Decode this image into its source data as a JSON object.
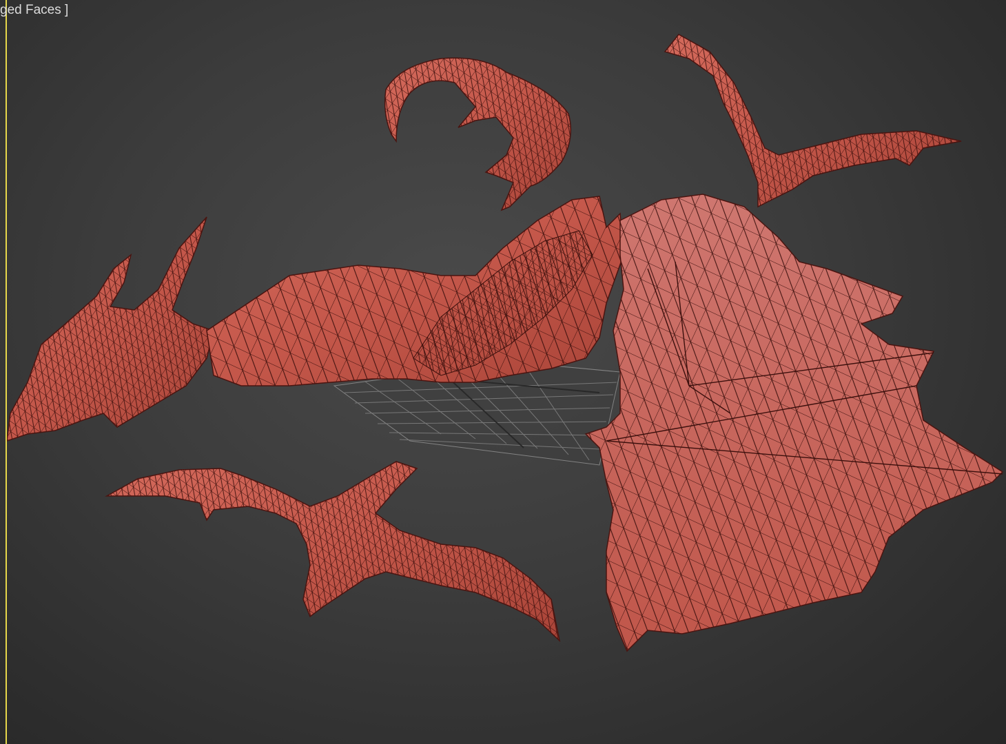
{
  "viewport": {
    "label": "ged Faces ]"
  },
  "colors": {
    "background": "#3c3c3c",
    "active_border": "#e8d84a",
    "mesh_fill": "#c4574a",
    "mesh_wire": "#3a0f0c",
    "grid": "#8a8a8a"
  },
  "icons": {
    "grid": "ground-grid-icon"
  }
}
